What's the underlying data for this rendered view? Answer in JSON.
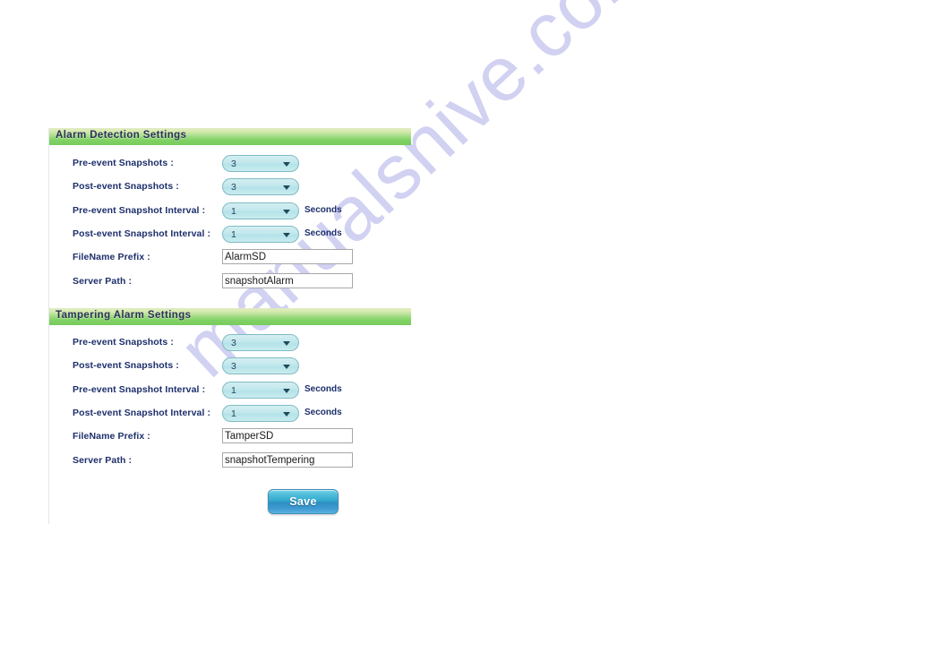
{
  "watermark": {
    "text": "manualshive.com"
  },
  "panel": {
    "sections": [
      {
        "id": "alarm-detection",
        "title": "Alarm Detection Settings",
        "rows": [
          {
            "label": "Pre-event Snapshots :",
            "control": "select",
            "value": "3",
            "unit": ""
          },
          {
            "label": "Post-event Snapshots :",
            "control": "select",
            "value": "3",
            "unit": ""
          },
          {
            "label": "Pre-event Snapshot Interval :",
            "control": "select",
            "value": "1",
            "unit": "Seconds"
          },
          {
            "label": "Post-event Snapshot Interval :",
            "control": "select",
            "value": "1",
            "unit": "Seconds"
          },
          {
            "label": "FileName Prefix :",
            "control": "text",
            "value": "AlarmSD",
            "unit": ""
          },
          {
            "label": "Server Path :",
            "control": "text",
            "value": "snapshotAlarm",
            "unit": ""
          }
        ]
      },
      {
        "id": "tampering-alarm",
        "title": "Tampering Alarm Settings",
        "rows": [
          {
            "label": "Pre-event Snapshots :",
            "control": "select",
            "value": "3",
            "unit": ""
          },
          {
            "label": "Post-event Snapshots :",
            "control": "select",
            "value": "3",
            "unit": ""
          },
          {
            "label": "Pre-event Snapshot Interval :",
            "control": "select",
            "value": "1",
            "unit": "Seconds"
          },
          {
            "label": "Post-event Snapshot Interval :",
            "control": "select",
            "value": "1",
            "unit": "Seconds"
          },
          {
            "label": "FileName Prefix :",
            "control": "text",
            "value": "TamperSD",
            "unit": ""
          },
          {
            "label": "Server Path :",
            "control": "text",
            "value": "snapshotTempering",
            "unit": ""
          }
        ]
      }
    ],
    "save_label": "Save"
  },
  "colors": {
    "header_green_top": "#e1ebc4",
    "header_green_bottom": "#77cc5c",
    "label_navy": "#1d2f6b",
    "pill_fill": "#c0e7ec",
    "pill_border": "#7fbcc4",
    "save_blue": "#2f8fc4",
    "watermark_purple": "#c9caf0"
  }
}
